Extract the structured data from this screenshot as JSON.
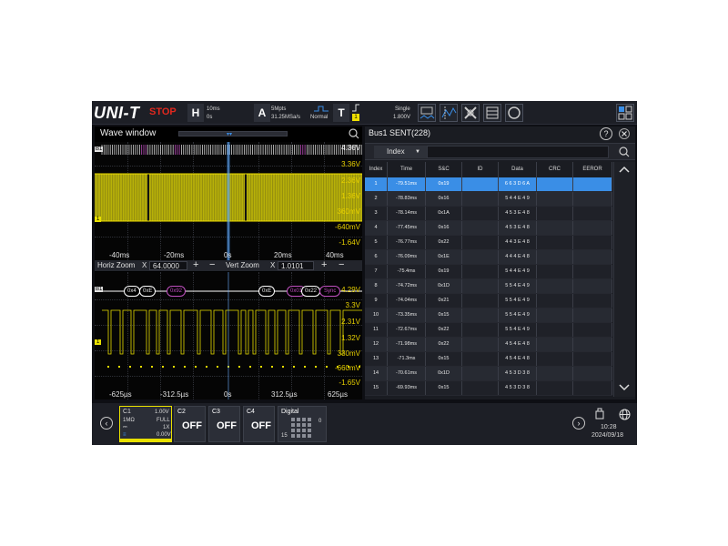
{
  "brand": "UNI-T",
  "run_state": "STOP",
  "horizontal": {
    "key": "H",
    "timebase": "10ms",
    "offset": "0s"
  },
  "acquire": {
    "key": "A",
    "depth": "5Mpts",
    "rate": "31.25MSa/s",
    "mode": "Normal"
  },
  "trigger": {
    "key": "T",
    "source": "1",
    "mode": "Single",
    "level": "1.800V"
  },
  "wave_window": {
    "title": "Wave window",
    "main_volt_labels": [
      "4.36V",
      "3.36V",
      "2.36V",
      "1.36V",
      "360mV",
      "-640mV",
      "-1.64V"
    ],
    "main_time_labels": [
      "-40ms",
      "-20ms",
      "0s",
      "20ms",
      "40ms"
    ],
    "zoom": {
      "horiz_label": "Horiz Zoom",
      "horiz_x": "X",
      "horiz_value": "64.0000",
      "vert_label": "Vert Zoom",
      "vert_x": "X",
      "vert_value": "1.0101",
      "plus": "+",
      "minus": "−"
    },
    "zoom_volt_labels": [
      "4.29V",
      "3.3V",
      "2.31V",
      "1.32V",
      "330mV",
      "-660mV",
      "-1.65V"
    ],
    "zoom_time_labels": [
      "-625µs",
      "-312.5µs",
      "0s",
      "312.5µs",
      "625µs"
    ],
    "bus_tag": "B1",
    "channel_tag": "1",
    "decode_boxes": [
      "0x4",
      "0xE",
      "0x92",
      "0xE",
      "0x01",
      "0x22",
      "Sync"
    ]
  },
  "bus_panel": {
    "title": "Bus1 SENT(228)",
    "filter": "Index",
    "columns": [
      "Index",
      "Time",
      "S&C",
      "ID",
      "Data",
      "CRC",
      "EEROR"
    ],
    "rows": [
      {
        "index": "1",
        "time": "-79.51ms",
        "sc": "0x19",
        "id": "",
        "data": "6 6 3 D 6 A",
        "crc": "",
        "err": ""
      },
      {
        "index": "2",
        "time": "-78.83ms",
        "sc": "0x16",
        "id": "",
        "data": "5 4 4 E 4 9",
        "crc": "",
        "err": ""
      },
      {
        "index": "3",
        "time": "-78.14ms",
        "sc": "0x1A",
        "id": "",
        "data": "4 5 3 E 4 8",
        "crc": "",
        "err": ""
      },
      {
        "index": "4",
        "time": "-77.45ms",
        "sc": "0x16",
        "id": "",
        "data": "4 5 3 E 4 8",
        "crc": "",
        "err": ""
      },
      {
        "index": "5",
        "time": "-76.77ms",
        "sc": "0x22",
        "id": "",
        "data": "4 4 3 E 4 8",
        "crc": "",
        "err": ""
      },
      {
        "index": "6",
        "time": "-76.09ms",
        "sc": "0x1E",
        "id": "",
        "data": "4 4 4 E 4 8",
        "crc": "",
        "err": ""
      },
      {
        "index": "7",
        "time": "-75.4ms",
        "sc": "0x19",
        "id": "",
        "data": "5 4 4 E 4 9",
        "crc": "",
        "err": ""
      },
      {
        "index": "8",
        "time": "-74.72ms",
        "sc": "0x1D",
        "id": "",
        "data": "5 5 4 E 4 9",
        "crc": "",
        "err": ""
      },
      {
        "index": "9",
        "time": "-74.04ms",
        "sc": "0x21",
        "id": "",
        "data": "5 5 4 E 4 9",
        "crc": "",
        "err": ""
      },
      {
        "index": "10",
        "time": "-73.35ms",
        "sc": "0x15",
        "id": "",
        "data": "5 5 4 E 4 9",
        "crc": "",
        "err": ""
      },
      {
        "index": "11",
        "time": "-72.67ms",
        "sc": "0x22",
        "id": "",
        "data": "5 5 4 E 4 9",
        "crc": "",
        "err": ""
      },
      {
        "index": "12",
        "time": "-71.98ms",
        "sc": "0x22",
        "id": "",
        "data": "4 5 4 E 4 8",
        "crc": "",
        "err": ""
      },
      {
        "index": "13",
        "time": "-71.3ms",
        "sc": "0x15",
        "id": "",
        "data": "4 5 4 E 4 8",
        "crc": "",
        "err": ""
      },
      {
        "index": "14",
        "time": "-70.61ms",
        "sc": "0x1D",
        "id": "",
        "data": "4 5 3 D 3 8",
        "crc": "",
        "err": ""
      },
      {
        "index": "15",
        "time": "-69.93ms",
        "sc": "0x15",
        "id": "",
        "data": "4 5 3 D 3 8",
        "crc": "",
        "err": ""
      }
    ]
  },
  "channels": {
    "c1": {
      "name": "C1",
      "scale": "1.00V",
      "coupling": "1MΩ",
      "bandwidth": "FULL",
      "probe": "1X",
      "offset": "0.00V"
    },
    "c2": {
      "name": "C2",
      "state": "OFF"
    },
    "c3": {
      "name": "C3",
      "state": "OFF"
    },
    "c4": {
      "name": "C4",
      "state": "OFF"
    },
    "digital": {
      "name": "Digital",
      "top": "0",
      "bottom": "15"
    }
  },
  "clock": {
    "time": "10:28",
    "date": "2024/09/18"
  },
  "colors": {
    "ch1": "#e8e000",
    "bus": "#ffffff",
    "selected_row": "#3a8ee6",
    "stop": "#e0281e",
    "decode": "#c050c0"
  }
}
